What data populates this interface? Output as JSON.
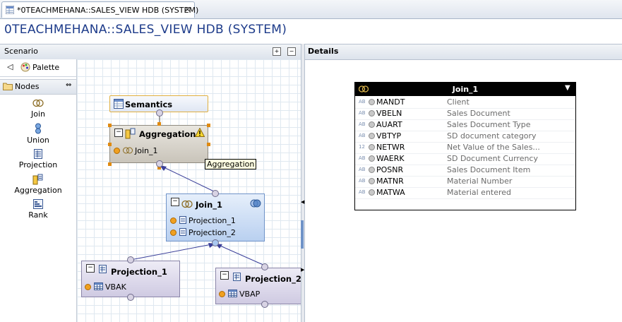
{
  "editor_tab": {
    "label": "*0TEACHMEHANA::SALES_VIEW HDB (SYSTEM)",
    "close": "✕"
  },
  "page_title": "0TEACHMEHANA::SALES_VIEW HDB (SYSTEM)",
  "scenario_panel": {
    "title": "Scenario"
  },
  "details_panel": {
    "title": "Details"
  },
  "palette": {
    "label": "Palette",
    "nodes_label": "Nodes",
    "items": [
      {
        "label": "Join",
        "icon": "join-icon"
      },
      {
        "label": "Union",
        "icon": "union-icon"
      },
      {
        "label": "Projection",
        "icon": "projection-icon"
      },
      {
        "label": "Aggregation",
        "icon": "aggregation-icon"
      },
      {
        "label": "Rank",
        "icon": "rank-icon"
      }
    ]
  },
  "diagram": {
    "semantics": {
      "title": "Semantics"
    },
    "aggregation": {
      "title": "Aggregation",
      "input": "Join_1",
      "tooltip": "Aggregation"
    },
    "join": {
      "title": "Join_1",
      "inputs": [
        "Projection_1",
        "Projection_2"
      ]
    },
    "projection_1": {
      "title": "Projection_1",
      "input": "VBAK"
    },
    "projection_2": {
      "title": "Projection_2",
      "input": "VBAP"
    }
  },
  "join_table": {
    "title": "Join_1",
    "rows": [
      {
        "type": "AB",
        "name": "MANDT",
        "desc": "Client"
      },
      {
        "type": "AB",
        "name": "VBELN",
        "desc": "Sales Document"
      },
      {
        "type": "AB",
        "name": "AUART",
        "desc": "Sales Document Type"
      },
      {
        "type": "AB",
        "name": "VBTYP",
        "desc": "SD document category"
      },
      {
        "type": "12",
        "name": "NETWR",
        "desc": "Net Value of the Sales..."
      },
      {
        "type": "AB",
        "name": "WAERK",
        "desc": "SD Document Currency"
      },
      {
        "type": "AB",
        "name": "POSNR",
        "desc": "Sales Document Item"
      },
      {
        "type": "AB",
        "name": "MATNR",
        "desc": "Material Number"
      },
      {
        "type": "AB",
        "name": "MATWA",
        "desc": "Material entered"
      }
    ]
  },
  "colors": {
    "title_blue": "#1d3b8a",
    "join_node": "#cfe0f7",
    "projection_node": "#d9d5e8",
    "aggregation_node": "#d6d3cc"
  }
}
